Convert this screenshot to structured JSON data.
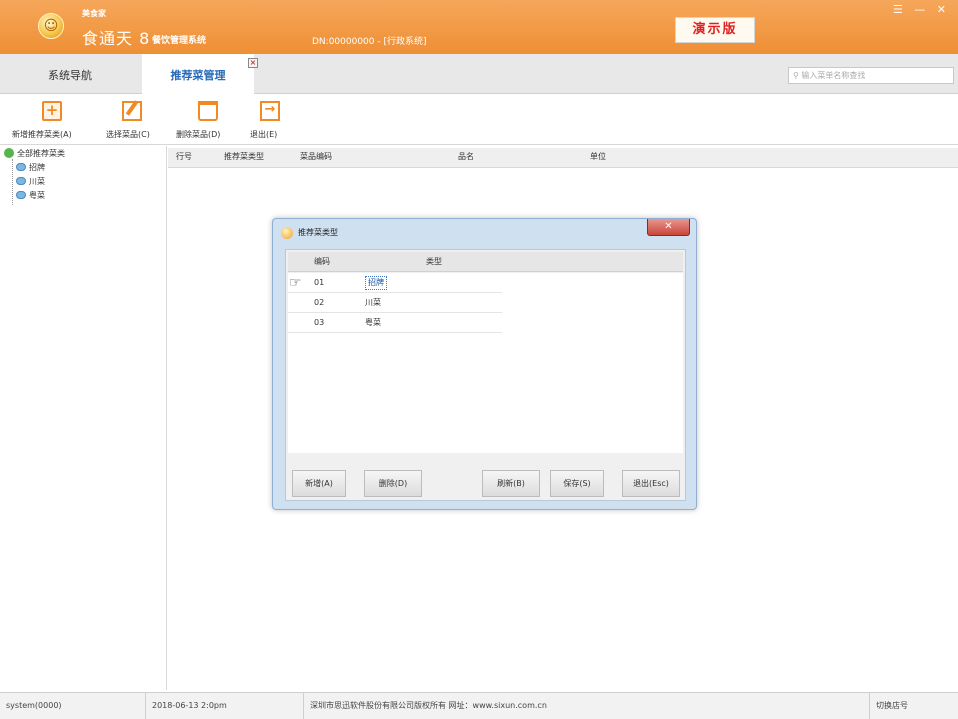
{
  "titlebar": {
    "brand_small": "美食家",
    "brand_main": "食通天 8",
    "brand_sub": "餐饮管理系统",
    "id_text": "DN:00000000 - [行政系统]",
    "demo_badge": "演示版",
    "minimize": "—",
    "close": "✕",
    "menu": "☰"
  },
  "tabs": {
    "nav_label": "系统导航",
    "active_label": "推荐菜管理",
    "close_glyph": "×"
  },
  "search": {
    "placeholder": "输入菜单名称查找"
  },
  "toolbar": {
    "add_label": "新增推荐菜类(A)",
    "select_label": "选择菜品(C)",
    "delete_label": "删除菜品(D)",
    "exit_label": "退出(E)"
  },
  "tree": {
    "root": "全部推荐菜类",
    "children": [
      "招牌",
      "川菜",
      "粤菜"
    ]
  },
  "grid": {
    "columns": [
      "行号",
      "推荐菜类型",
      "菜品编码",
      "品名",
      "单位"
    ]
  },
  "dialog": {
    "title": "推荐菜类型",
    "close_glyph": "✕",
    "columns": [
      "编码",
      "类型"
    ],
    "rows": [
      {
        "code": "01",
        "type": "招牌"
      },
      {
        "code": "02",
        "type": "川菜"
      },
      {
        "code": "03",
        "type": "粤菜"
      }
    ],
    "buttons": {
      "new": "新增(A)",
      "delete": "删除(D)",
      "refresh": "刷新(B)",
      "save": "保存(S)",
      "exit": "退出(Esc)"
    }
  },
  "statusbar": {
    "user": "system(0000)",
    "datetime": "2018-06-13 2:0pm",
    "copyright": "深圳市思迅软件股份有限公司版权所有  网址：www.sixun.com.cn",
    "switch_shop": "切换店号"
  }
}
